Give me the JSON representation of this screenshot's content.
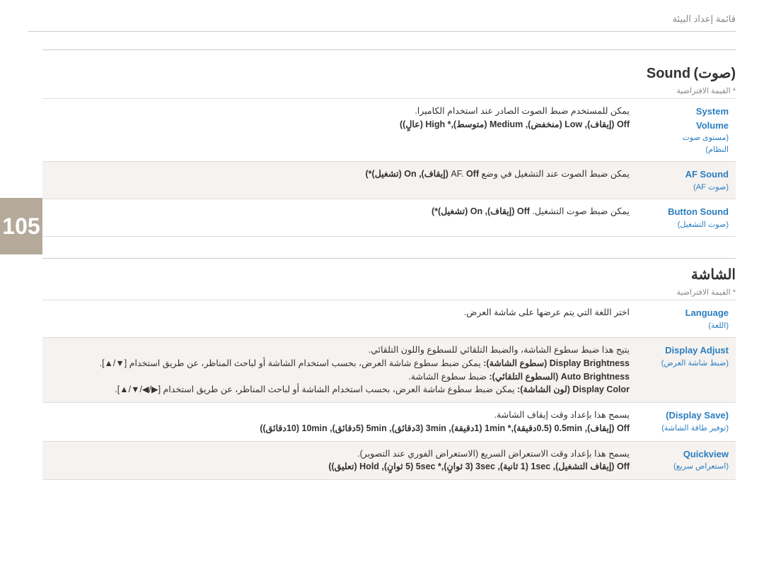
{
  "header": {
    "title": "قائمة إعداد البيئة"
  },
  "page_number": "105",
  "sound_section": {
    "title_ar": "(صوت)",
    "title_en": "Sound",
    "default_note": "* القيمة الافتراضية",
    "rows": [
      {
        "label_en": "System Volume",
        "label_ar": "(مستوى صوت النظام)",
        "description": "يمكن للمستخدم ضبط الصوت الصادر عند استخدام الكاميرا.",
        "description_bold": "Off (إيقاف), Low (منخفض), Medium (متوسط),* High (عالٍ))",
        "bg": "white"
      },
      {
        "label_en": "AF Sound",
        "label_ar": "(صوت AF)",
        "description": "يمكن ضبط الصوت عند التشغيل في وضع AF.",
        "description_bold": "Off (إيقاف), On (تشغيل)*)",
        "bg": "light"
      },
      {
        "label_en": "Button Sound",
        "label_ar": "(صوت التشغيل)",
        "description": "يمكن ضبط صوت التشغيل.",
        "description_bold": "Off (إيقاف), On (تشغيل)*)",
        "bg": "white"
      }
    ]
  },
  "display_section": {
    "title_ar": "الشاشة",
    "default_note": "* القيمة الافتراضية",
    "rows": [
      {
        "label_en": "Language",
        "label_ar": "(اللغة)",
        "description": "اختر اللغة التي يتم عرضها على شاشة العرض.",
        "bg": "white"
      },
      {
        "label_en": "Display Adjust",
        "label_ar": "(ضبط شاشة العرض)",
        "description_parts": [
          "يتيح هذا ضبط سطوع الشاشة، والضبط التلقائي للسطوع واللون التلقائي.",
          "Display Brightness (سطوع الشاشة): يمكن ضبط سطوع شاشة العرض، بحسب استخدام الشاشة أو لباحث المناظر، عن طريق استخدام [▼/▲].",
          "Auto Brightness (السطوع التلقائي): ضبط سطوع الشاشة.",
          "Display Color (لون الشاشة): يمكن ضبط سطوع شاشة العرض، بحسب استخدام الشاشة أو لباحث المناظر، عن طريق استخدام [▶/◀/▼/▲]."
        ],
        "bg": "light"
      },
      {
        "label_en": "(Display Save)",
        "label_ar": "(توفير طاقة الشاشة)",
        "description": "يسمح هذا بإعداد وقت إيقاف الشاشة.",
        "description_bold": "Off (إيقاف), 0.5min (0.5دقيقة),* 1min (1دقيقة), 3min (3دقائق), 5min (5دقائق), 10min (10دقائق))",
        "bg": "white"
      },
      {
        "label_en": "Quickview",
        "label_ar": "(استعراض سريع)",
        "description": "يسمح هذا بإعداد وقت الاستعراض السريع (الاستعراض الفوري عند التصوير).",
        "description_bold": "Off (إيقاف التشغيل), 1sec (1 ثانية), 3sec (3 ثوانٍ),* 5sec (5 ثوانٍ), Hold (تعليق))",
        "bg": "light"
      }
    ]
  }
}
